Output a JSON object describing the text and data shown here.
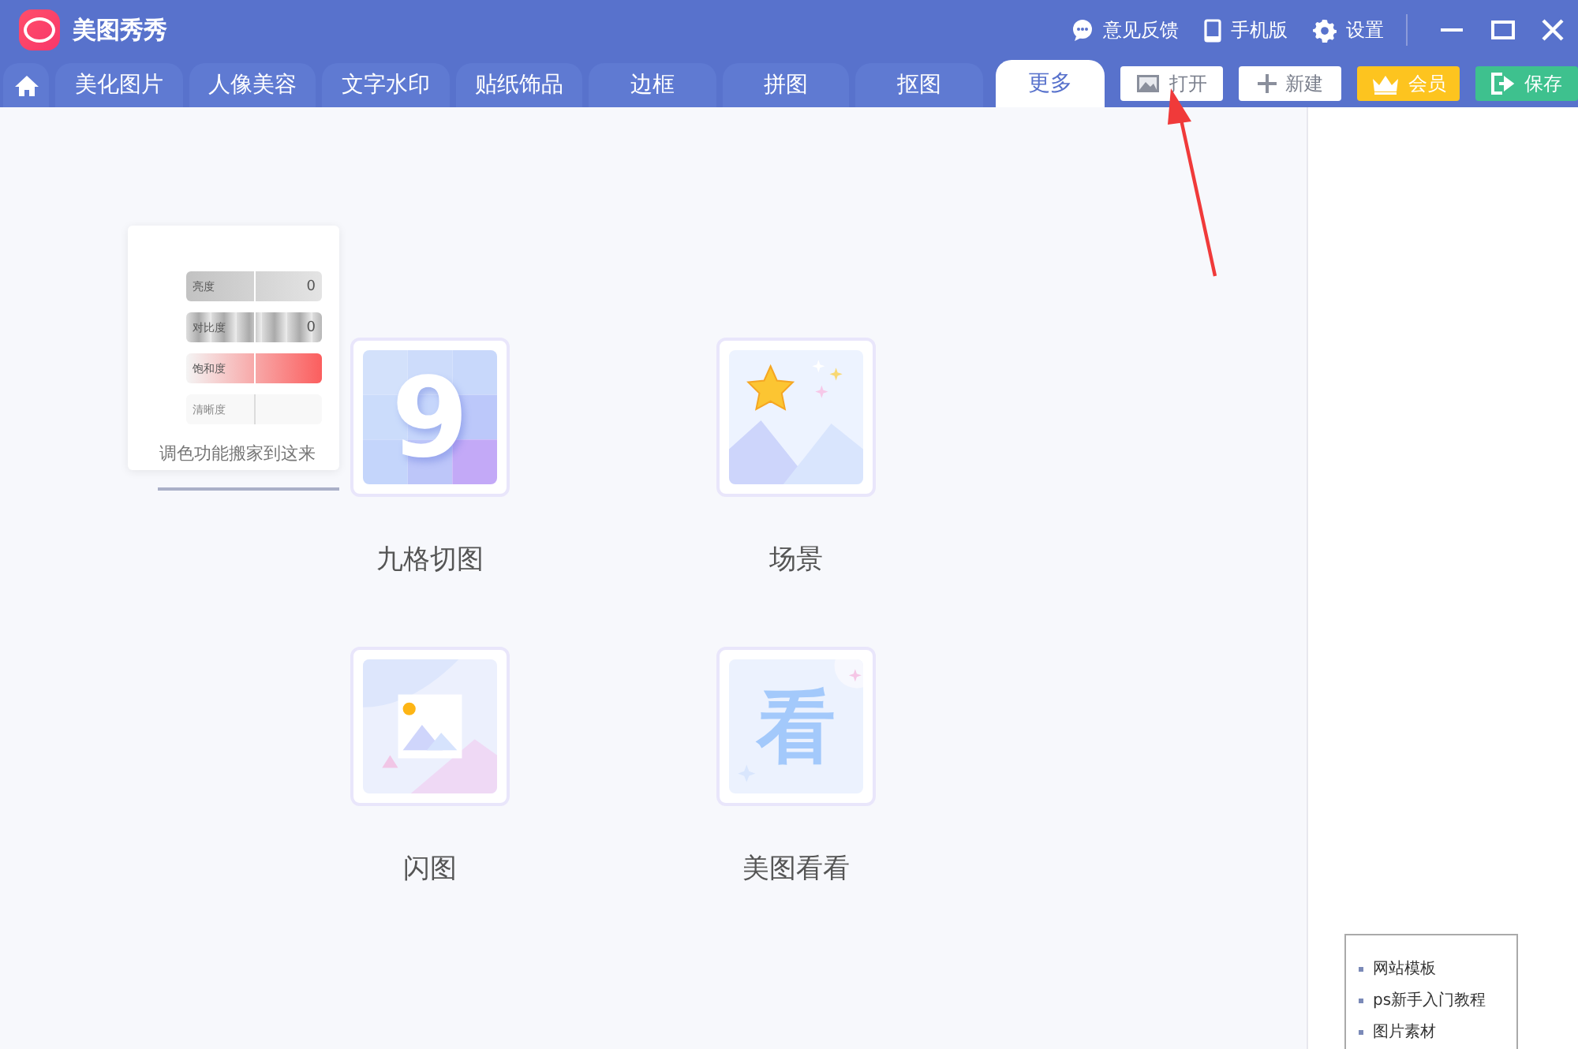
{
  "window": {
    "title": "美图秀秀",
    "links": [
      {
        "kind": "feedback",
        "label": "意见反馈"
      },
      {
        "kind": "mobile",
        "label": "手机版"
      },
      {
        "kind": "settings",
        "label": "设置"
      }
    ]
  },
  "tabs": [
    {
      "kind": "home",
      "selected": false
    },
    {
      "label": "美化图片",
      "selected": false
    },
    {
      "label": "人像美容",
      "selected": false
    },
    {
      "label": "文字水印",
      "selected": false
    },
    {
      "label": "贴纸饰品",
      "selected": false
    },
    {
      "label": "边框",
      "selected": false
    },
    {
      "label": "拼图",
      "selected": false
    },
    {
      "label": "抠图",
      "selected": false
    },
    {
      "label": "更多",
      "selected": true
    }
  ],
  "actions": [
    {
      "kind": "open",
      "label": "打开"
    },
    {
      "kind": "new",
      "label": "新建"
    },
    {
      "kind": "vip",
      "label": "会员"
    },
    {
      "kind": "save",
      "label": "保存"
    }
  ],
  "popup": {
    "rows": [
      {
        "label": "亮度",
        "value": "0",
        "kind": "gray",
        "level": 0.5
      },
      {
        "label": "对比度",
        "value": "0",
        "kind": "stripe",
        "level": 0.5
      },
      {
        "label": "饱和度",
        "kind": "red",
        "level": 0.5
      },
      {
        "label": "清晰度",
        "kind": "faded",
        "level": 0.5
      }
    ],
    "message": "调色功能搬家到这来"
  },
  "tools": [
    {
      "kind": "grid",
      "glyph": "9",
      "label": "九格切图"
    },
    {
      "kind": "scene",
      "label": "场景"
    },
    {
      "kind": "flash",
      "label": "闪图"
    },
    {
      "kind": "look",
      "glyph": "看",
      "label": "美图看看"
    }
  ],
  "side_box": {
    "items": [
      "网站模板",
      "ps新手入门教程",
      "图片素材"
    ]
  }
}
